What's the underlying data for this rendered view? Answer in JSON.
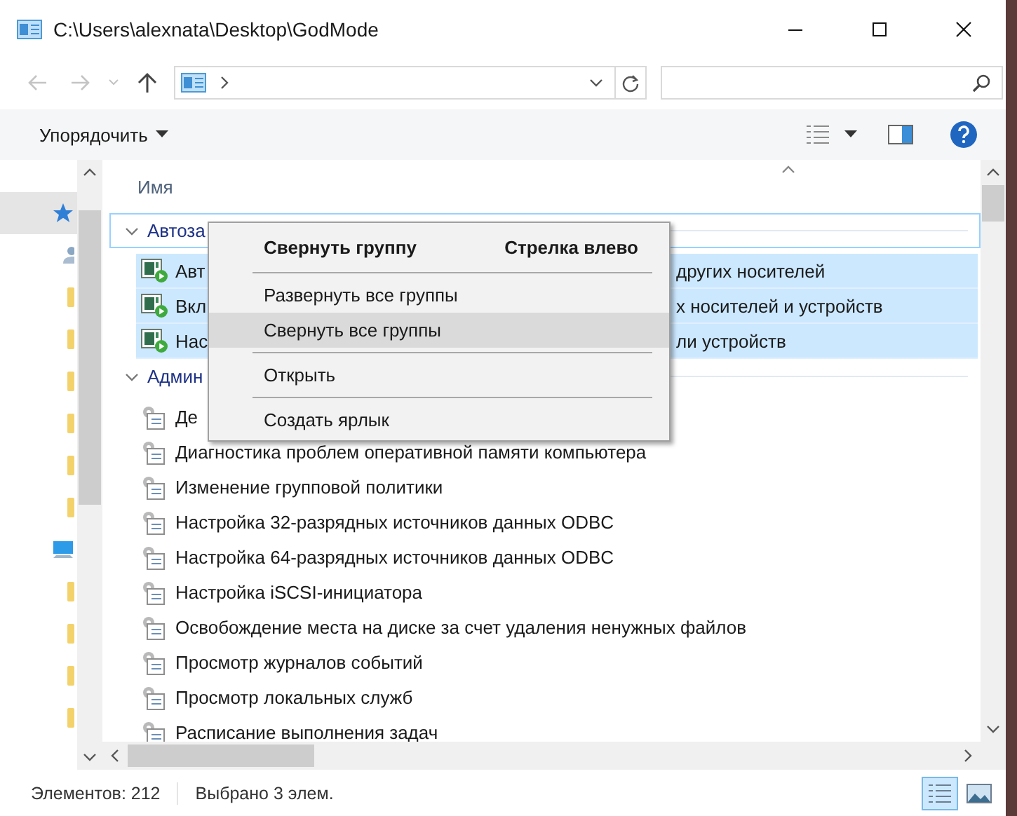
{
  "window": {
    "title": "C:\\Users\\alexnata\\Desktop\\GodMode"
  },
  "toolbar": {
    "organize": "Упорядочить"
  },
  "nav": {
    "items": [
      {
        "kind": "star",
        "selected": true
      },
      {
        "kind": "person",
        "selected": false
      },
      {
        "kind": "folder",
        "selected": false
      },
      {
        "kind": "folder",
        "selected": false
      },
      {
        "kind": "folder",
        "selected": false
      },
      {
        "kind": "folder",
        "selected": false
      },
      {
        "kind": "folder",
        "selected": false
      },
      {
        "kind": "folder",
        "selected": false
      },
      {
        "kind": "computer",
        "selected": false
      },
      {
        "kind": "folder",
        "selected": false
      },
      {
        "kind": "folder",
        "selected": false
      },
      {
        "kind": "folder",
        "selected": false
      },
      {
        "kind": "folder",
        "selected": false
      }
    ]
  },
  "list": {
    "column": "Имя",
    "groups": [
      {
        "label": "Автоза",
        "focused": true,
        "items": [
          {
            "kind": "autoplay",
            "text": "Авт",
            "tail": "других носителей",
            "selected": true
          },
          {
            "kind": "autoplay",
            "text": "Вкл",
            "tail": "х носителей и устройств",
            "selected": true
          },
          {
            "kind": "autoplay",
            "text": "Нас",
            "tail": "ли устройств",
            "selected": true
          }
        ]
      },
      {
        "label": "Админ",
        "focused": false,
        "items": [
          {
            "kind": "admin",
            "text": "Де",
            "selected": false
          },
          {
            "kind": "admin",
            "text": "Диагностика проблем оперативной памяти компьютера",
            "selected": false
          },
          {
            "kind": "admin",
            "text": "Изменение групповой политики",
            "selected": false
          },
          {
            "kind": "admin",
            "text": "Настройка 32-разрядных источников данных ODBC",
            "selected": false
          },
          {
            "kind": "admin",
            "text": "Настройка 64-разрядных источников данных ODBC",
            "selected": false
          },
          {
            "kind": "admin",
            "text": "Настройка iSCSI-инициатора",
            "selected": false
          },
          {
            "kind": "admin",
            "text": "Освобождение места на диске за счет удаления ненужных файлов",
            "selected": false
          },
          {
            "kind": "admin",
            "text": "Просмотр журналов событий",
            "selected": false
          },
          {
            "kind": "admin",
            "text": "Просмотр локальных служб",
            "selected": false
          },
          {
            "kind": "admin",
            "text": "Расписание выполнения задач",
            "selected": false
          }
        ]
      }
    ]
  },
  "context_menu": {
    "items": [
      {
        "kind": "command",
        "label": "Свернуть группу",
        "shortcut": "Стрелка влево",
        "default": true,
        "highlighted": false
      },
      {
        "kind": "separator"
      },
      {
        "kind": "command",
        "label": "Развернуть все группы",
        "default": false,
        "highlighted": false
      },
      {
        "kind": "command",
        "label": "Свернуть все группы",
        "default": false,
        "highlighted": true
      },
      {
        "kind": "separator"
      },
      {
        "kind": "command",
        "label": "Открыть",
        "default": false,
        "highlighted": false
      },
      {
        "kind": "separator"
      },
      {
        "kind": "command",
        "label": "Создать ярлык",
        "default": false,
        "highlighted": false
      }
    ]
  },
  "status_bar": {
    "count": "Элементов: 212",
    "selection": "Выбрано 3 элем.",
    "views": [
      {
        "kind": "details",
        "selected": true
      },
      {
        "kind": "preview",
        "selected": false
      }
    ]
  }
}
